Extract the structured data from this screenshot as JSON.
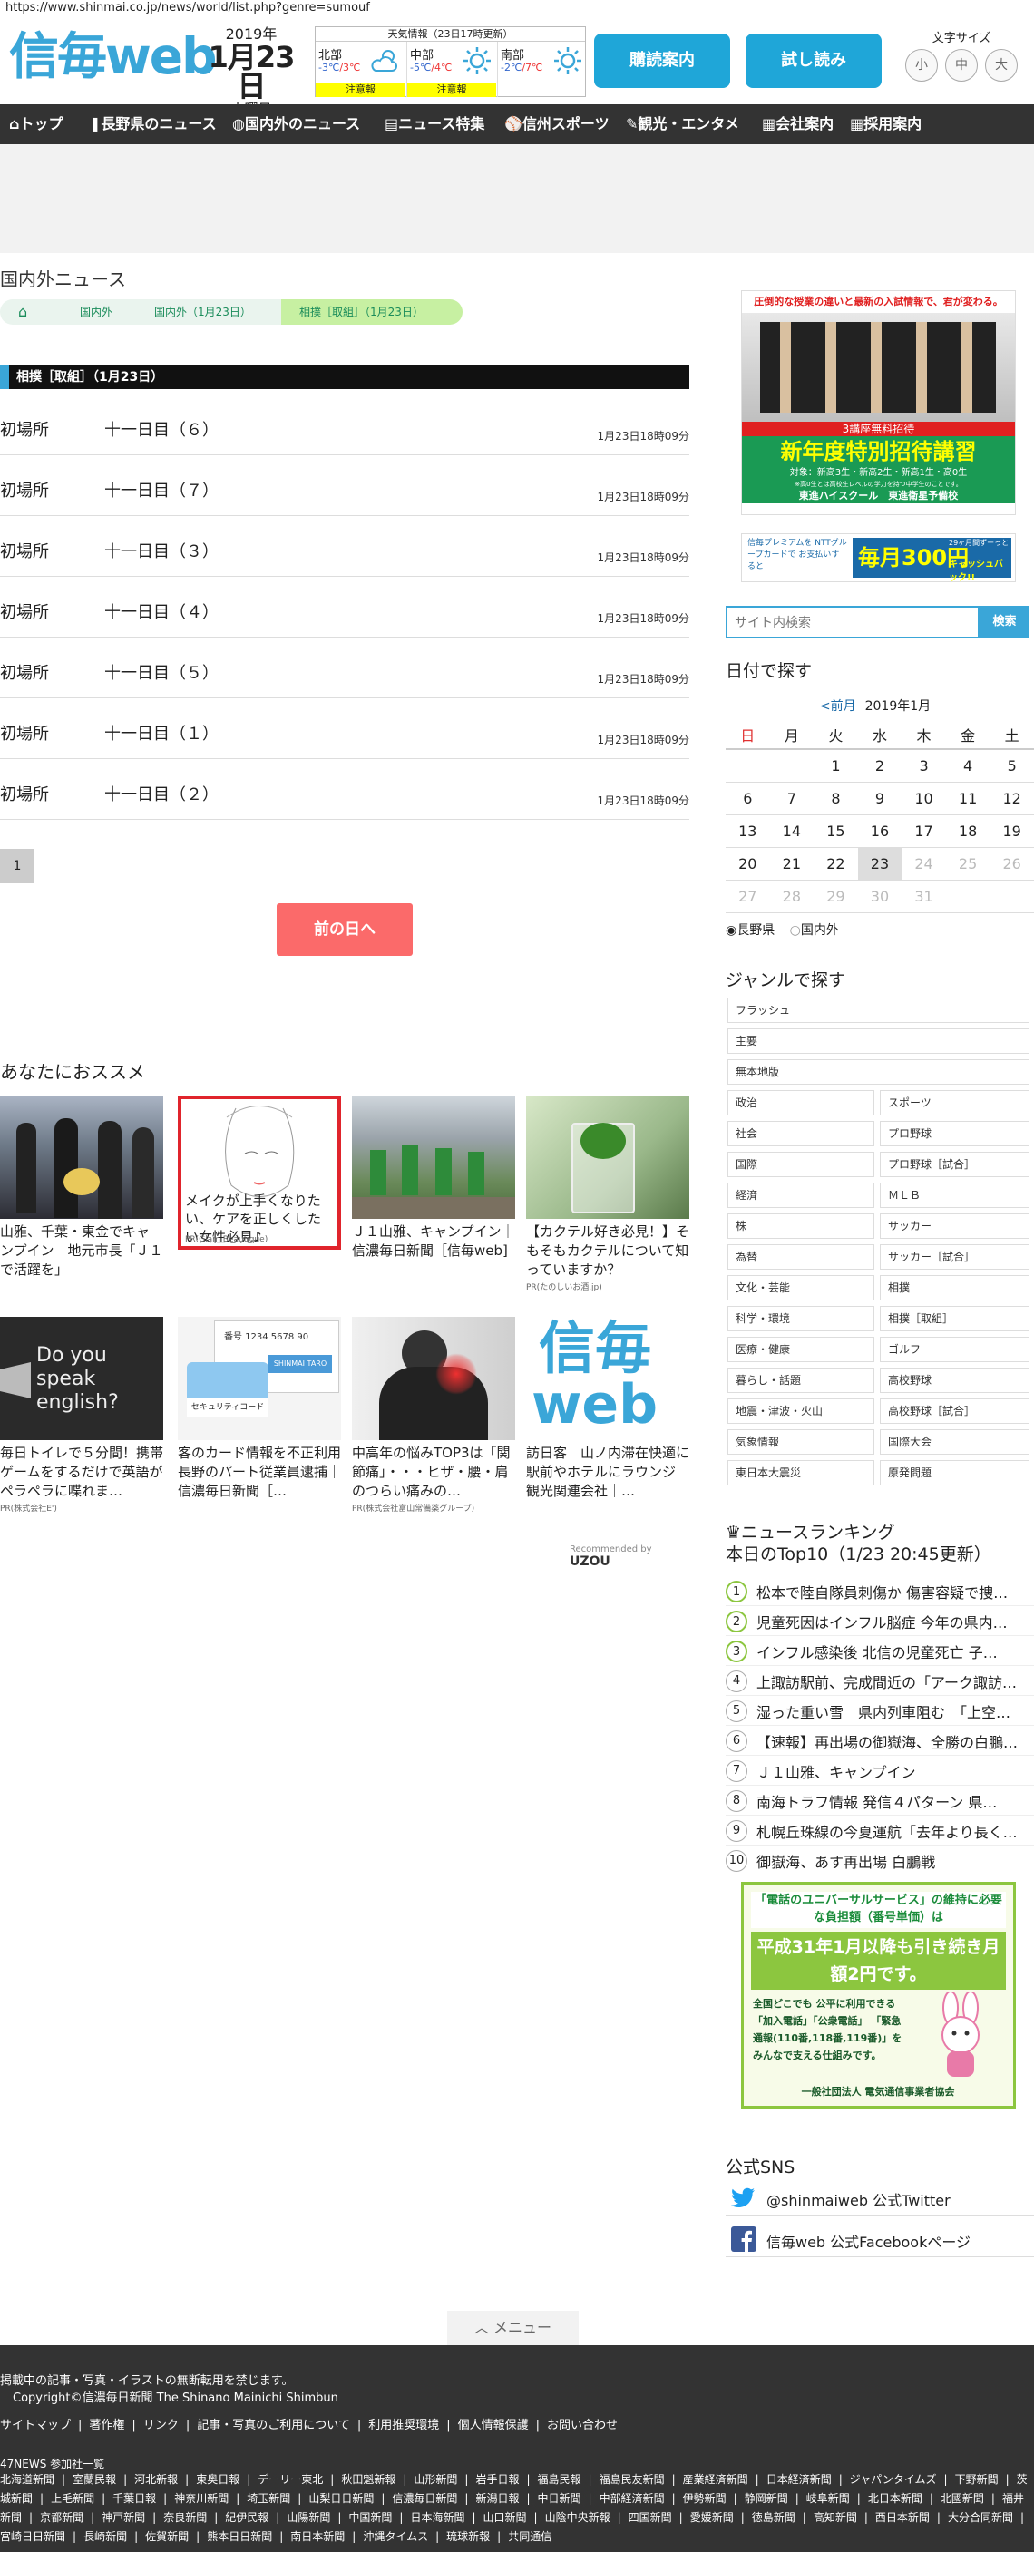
{
  "url": "https://www.shinmai.co.jp/news/world/list.php?genre=sumouf",
  "header": {
    "logo": "信毎web",
    "date_year": "2019年",
    "date_day": "1月23日",
    "date_week": "水曜日",
    "weather_title": "天気情報（23日17時更新）",
    "regions": [
      {
        "name": "北部",
        "low": "-3℃",
        "high": "3℃",
        "alert": "注意報"
      },
      {
        "name": "中部",
        "low": "-5℃",
        "high": "4℃",
        "alert": "注意報"
      },
      {
        "name": "南部",
        "low": "-2℃",
        "high": "7℃",
        "alert": ""
      }
    ],
    "delivery_button": "購読案内",
    "trial_button": "試し読み",
    "font_size_label": "文字サイズ",
    "font_sizes": [
      "小",
      "中",
      "大"
    ]
  },
  "nav": [
    "トップ",
    "長野県のニュース",
    "国内外のニュース",
    "ニュース特集",
    "信州スポーツ",
    "観光・エンタメ",
    "会社案内",
    "採用案内"
  ],
  "main": {
    "section_title": "国内外ニュース",
    "breadcrumb": [
      "国内外",
      "国内外（1月23日）",
      "相撲［取組］（1月23日）"
    ],
    "category_bar": "相撲［取組］（1月23日）",
    "articles": [
      {
        "a": "初場所",
        "b": "十一日目（６）",
        "time": "1月23日18時09分"
      },
      {
        "a": "初場所",
        "b": "十一日目（７）",
        "time": "1月23日18時09分"
      },
      {
        "a": "初場所",
        "b": "十一日目（３）",
        "time": "1月23日18時09分"
      },
      {
        "a": "初場所",
        "b": "十一日目（４）",
        "time": "1月23日18時09分"
      },
      {
        "a": "初場所",
        "b": "十一日目（５）",
        "time": "1月23日18時09分"
      },
      {
        "a": "初場所",
        "b": "十一日目（１）",
        "time": "1月23日18時09分"
      },
      {
        "a": "初場所",
        "b": "十一日目（２）",
        "time": "1月23日18時09分"
      }
    ],
    "page": "1",
    "prev_day": "前の日へ",
    "rec_title": "あなたにおススメ",
    "recs": [
      {
        "cap": "山雅、千葉・東金でキャンプイン　地元市長「Ｊ１で活躍を」",
        "pr": ""
      },
      {
        "cap": "メイクが上手くなりたい、ケアを正しくしたい女性必見♪",
        "pr": "PR(Glam Beautique)"
      },
      {
        "cap": "Ｊ１山雅、キャンプイン｜信濃毎日新聞［信毎web]",
        "pr": ""
      },
      {
        "cap": "【カクテル好き必見！】そもそもカクテルについて知っていますか？",
        "pr": "PR(たのしいお酒.jp)"
      },
      {
        "cap": "毎日トイレで５分間！携帯ゲームをするだけで英語がペラペラに喋れま…",
        "pr": "PR(株式会社E')"
      },
      {
        "cap": "客のカード情報を不正利用　長野のパート従業員逮捕｜信濃毎日新聞［…",
        "pr": ""
      },
      {
        "cap": "中高年の悩みTOP3は「関節痛」・・・ヒザ・腰・肩のつらい痛みの…",
        "pr": "PR(株式会社富山常備薬グループ)"
      },
      {
        "cap": "訪日客　山ノ内滞在快適に　駅前やホテルにラウンジ　観光関連会社｜…",
        "pr": ""
      }
    ],
    "recs_card_text": {
      "english": "Do you speak english?",
      "card_number": "番号 1234 5678 90",
      "card_tab": "SHINMAI TARO",
      "security": "セキュリティコード",
      "logo_top": "信毎",
      "logo_bottom": "web"
    },
    "recommended_by": "Recommended by",
    "uzou": "UZOU"
  },
  "side": {
    "ad1_text": "圧倒的な授業の違いと最新の入試情報で、君が変わる。",
    "ad1_band": "3講座無料招待",
    "ad1_main": "新年度特別招待講習",
    "ad1_sub": "対象：新高3生・新高2生・新高1生・高0生",
    "ad1_note": "※高0生とは高校生レベルの学力を持つ中学生のことです。",
    "ad1_brand": "東進ハイスクール　東進衛星予備校",
    "ad2_text": "信毎プレミアムを NTTグループカードで お支払いすると",
    "ad2_prize": "毎月300円",
    "ad2_back": "キャッシュバック!!",
    "ad2_tag": "29ヶ月間ずーっと",
    "search_placeholder": "サイト内検索",
    "search_button": "検索",
    "cal_title": "日付で探す",
    "cal_prev": "<前月",
    "cal_month": "2019年1月",
    "weekdays": [
      "日",
      "月",
      "火",
      "水",
      "木",
      "金",
      "土"
    ],
    "weeks": [
      [
        "",
        "",
        "1",
        "2",
        "3",
        "4",
        "5"
      ],
      [
        "6",
        "7",
        "8",
        "9",
        "10",
        "11",
        "12"
      ],
      [
        "13",
        "14",
        "15",
        "16",
        "17",
        "18",
        "19"
      ],
      [
        "20",
        "21",
        "22",
        "23",
        "24",
        "25",
        "26"
      ],
      [
        "27",
        "28",
        "29",
        "30",
        "31",
        "",
        ""
      ]
    ],
    "radio1": "長野県",
    "radio2": "国内外",
    "genre_title": "ジャンルで探す",
    "genre_full": [
      "フラッシュ",
      "主要",
      "無本地版"
    ],
    "genre_pairs": [
      [
        "政治",
        "スポーツ"
      ],
      [
        "社会",
        "プロ野球"
      ],
      [
        "国際",
        "プロ野球［試合］"
      ],
      [
        "経済",
        "ＭＬＢ"
      ],
      [
        "株",
        "サッカー"
      ],
      [
        "為替",
        "サッカー［試合］"
      ],
      [
        "文化・芸能",
        "相撲"
      ],
      [
        "科学・環境",
        "相撲［取組］"
      ],
      [
        "医療・健康",
        "ゴルフ"
      ],
      [
        "暮らし・話題",
        "高校野球"
      ],
      [
        "地震・津波・火山",
        "高校野球［試合］"
      ],
      [
        "気象情報",
        "国際大会"
      ],
      [
        "東日本大震災",
        "原発問題"
      ]
    ],
    "rank_title": "ニュースランキング",
    "rank_sub": "本日のTop10（1/23 20:45更新）",
    "ranks": [
      "松本で陸自隊員刺傷か 傷害容疑で捜…",
      "児童死因はインフル脳症 今年の県内…",
      "インフル感染後 北信の児童死亡 子…",
      "上諏訪駅前、完成間近の「アーク諏訪…",
      "湿った重い雪　県内列車阻む　「上空…",
      "【速報】再出場の御嶽海、全勝の白鵬…",
      "Ｊ１山雅、キャンプイン",
      "南海トラフ情報 発信４パターン 県…",
      "札幌丘珠線の今夏運航「去年より長く…",
      "御嶽海、あす再出場 白鵬戦"
    ],
    "ad3_title": "「電話のユニバーサルサービス」の維持に必要な負担額（番号単価）は",
    "ad3_main": "平成31年1月以降も引き続き月額2円です。",
    "ad3_text": "全国どこでも 公平に利用できる 「加入電話」「公衆電話」 「緊急通報(110番,118番,119番)」を みんなで支える仕組みです。",
    "ad3_org": "一般社団法人 電気通信事業者協会",
    "sns_title": "公式SNS",
    "twitter": "@shinmaiweb 公式Twitter",
    "facebook": "信毎web 公式Facebookページ"
  },
  "menu_tab": "メニュー",
  "footer": {
    "line1": "掲載中の記事・写真・イラストの無断転用を禁じます。",
    "line2": "Copyright©信濃毎日新聞 The Shinano Mainichi Shimbun",
    "links": [
      "サイトマップ",
      "著作権",
      "リンク",
      "記事・写真のご利用について",
      "利用推奨環境",
      "個人情報保護",
      "お問い合わせ"
    ],
    "s47": "47NEWS 参加社一覧",
    "papers": [
      "北海道新聞",
      "室蘭民報",
      "河北新報",
      "東奥日報",
      "デーリー東北",
      "秋田魁新報",
      "山形新聞",
      "岩手日報",
      "福島民報",
      "福島民友新聞",
      "産業経済新聞",
      "日本経済新聞",
      "ジャパンタイムズ",
      "下野新聞",
      "茨城新聞",
      "上毛新聞",
      "千葉日報",
      "神奈川新聞",
      "埼玉新聞",
      "山梨日日新聞",
      "信濃毎日新聞",
      "新潟日報",
      "中日新聞",
      "中部経済新聞",
      "伊勢新聞",
      "静岡新聞",
      "岐阜新聞",
      "北日本新聞",
      "北國新聞",
      "福井新聞",
      "京都新聞",
      "神戸新聞",
      "奈良新聞",
      "紀伊民報",
      "山陽新聞",
      "中国新聞",
      "日本海新聞",
      "山口新聞",
      "山陰中央新報",
      "四国新聞",
      "愛媛新聞",
      "徳島新聞",
      "高知新聞",
      "西日本新聞",
      "大分合同新聞",
      "宮崎日日新聞",
      "長崎新聞",
      "佐賀新聞",
      "熊本日日新聞",
      "南日本新聞",
      "沖縄タイムス",
      "琉球新報",
      "共同通信"
    ]
  },
  "colors": {
    "brand": "#3aa6d8",
    "nav": "#333333",
    "prev": "#fb6a6a",
    "crumb_active": "#c7f0a2"
  }
}
